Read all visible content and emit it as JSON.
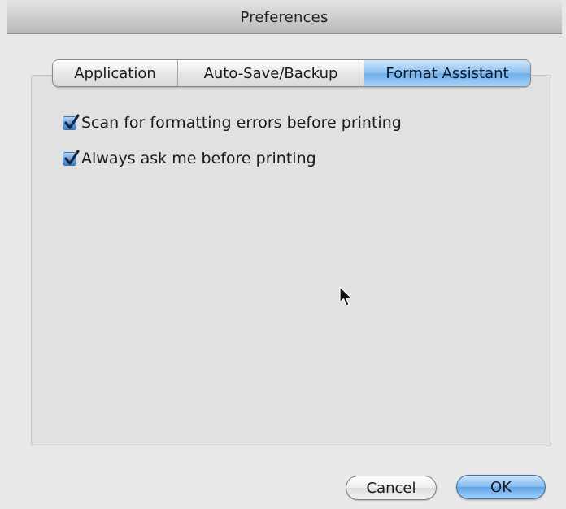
{
  "window": {
    "title": "Preferences"
  },
  "tabs": [
    {
      "label": "Application",
      "selected": false
    },
    {
      "label": "Auto-Save/Backup",
      "selected": false
    },
    {
      "label": "Format Assistant",
      "selected": true
    }
  ],
  "options": [
    {
      "label": "Scan for formatting errors before printing",
      "checked": true
    },
    {
      "label": "Always ask me before printing",
      "checked": true
    }
  ],
  "buttons": {
    "cancel_label": "Cancel",
    "ok_label": "OK"
  },
  "colors": {
    "accent": "#6eaee9",
    "checkbox": "#3f83d1"
  },
  "icons": {
    "checkmark": "checkmark-icon",
    "pointer": "mouse-pointer-icon"
  }
}
